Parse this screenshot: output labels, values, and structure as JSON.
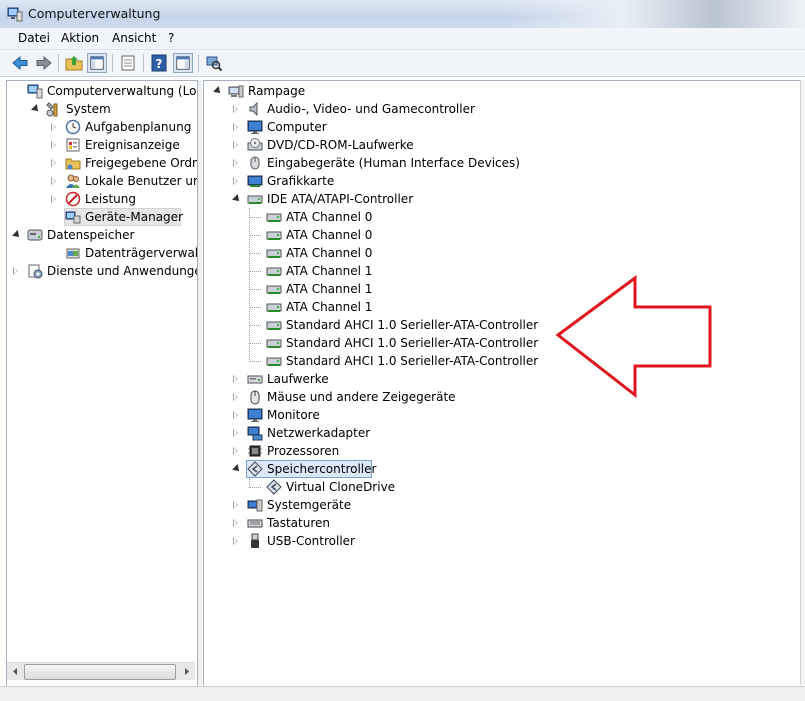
{
  "window": {
    "title": "Computerverwaltung"
  },
  "menu": [
    "Datei",
    "Aktion",
    "Ansicht",
    "?"
  ],
  "toolbar": {
    "buttons": [
      "back-arrow-icon",
      "forward-arrow-icon",
      "up-folder-icon",
      "show-hide-console-tree-icon",
      "properties-icon",
      "help-icon",
      "show-hide-action-pane-icon",
      "scan-hardware-icon"
    ]
  },
  "left_tree": [
    {
      "label": "Computerverwaltung (Lokal)",
      "icon": "computer-management-icon",
      "expander": "none",
      "level": 0
    },
    {
      "label": "System",
      "icon": "system-tools-icon",
      "expander": "open",
      "level": 1
    },
    {
      "label": "Aufgabenplanung",
      "icon": "clock-icon",
      "expander": "closed",
      "level": 2
    },
    {
      "label": "Ereignisanzeige",
      "icon": "event-viewer-icon",
      "expander": "closed",
      "level": 2
    },
    {
      "label": "Freigegebene Ordner",
      "icon": "shared-folder-icon",
      "expander": "closed",
      "level": 2
    },
    {
      "label": "Lokale Benutzer und Gr",
      "icon": "users-icon",
      "expander": "closed",
      "level": 2
    },
    {
      "label": "Leistung",
      "icon": "performance-icon",
      "expander": "closed",
      "level": 2
    },
    {
      "label": "Geräte-Manager",
      "icon": "device-manager-icon",
      "expander": "none",
      "level": 2,
      "selected": true
    },
    {
      "label": "Datenspeicher",
      "icon": "storage-icon",
      "expander": "open",
      "level": 0
    },
    {
      "label": "Datenträgerverwaltung",
      "icon": "disk-management-icon",
      "expander": "none",
      "level": 2
    },
    {
      "label": "Dienste und Anwendungen",
      "icon": "services-icon",
      "expander": "closed",
      "level": 0
    }
  ],
  "device_tree": [
    {
      "label": "Rampage",
      "icon": "computer-root-icon",
      "expander": "open",
      "level": 0
    },
    {
      "label": "Audio-, Video- und Gamecontroller",
      "icon": "speaker-icon",
      "expander": "closed",
      "level": 1
    },
    {
      "label": "Computer",
      "icon": "monitor-icon",
      "expander": "closed",
      "level": 1
    },
    {
      "label": "DVD/CD-ROM-Laufwerke",
      "icon": "cd-drive-icon",
      "expander": "closed",
      "level": 1
    },
    {
      "label": "Eingabegeräte (Human Interface Devices)",
      "icon": "hid-icon",
      "expander": "closed",
      "level": 1
    },
    {
      "label": "Grafikkarte",
      "icon": "display-adapter-icon",
      "expander": "closed",
      "level": 1
    },
    {
      "label": "IDE ATA/ATAPI-Controller",
      "icon": "ide-controller-icon",
      "expander": "open",
      "level": 1
    },
    {
      "label": "ATA Channel 0",
      "icon": "ide-channel-icon",
      "level": 2
    },
    {
      "label": "ATA Channel 0",
      "icon": "ide-channel-icon",
      "level": 2
    },
    {
      "label": "ATA Channel 0",
      "icon": "ide-channel-icon",
      "level": 2
    },
    {
      "label": "ATA Channel 1",
      "icon": "ide-channel-icon",
      "level": 2
    },
    {
      "label": "ATA Channel 1",
      "icon": "ide-channel-icon",
      "level": 2
    },
    {
      "label": "ATA Channel 1",
      "icon": "ide-channel-icon",
      "level": 2
    },
    {
      "label": "Standard AHCI 1.0 Serieller-ATA-Controller",
      "icon": "ide-channel-icon",
      "level": 2
    },
    {
      "label": "Standard AHCI 1.0 Serieller-ATA-Controller",
      "icon": "ide-channel-icon",
      "level": 2
    },
    {
      "label": "Standard AHCI 1.0 Serieller-ATA-Controller",
      "icon": "ide-channel-icon",
      "level": 2
    },
    {
      "label": "Laufwerke",
      "icon": "disk-drive-icon",
      "expander": "closed",
      "level": 1
    },
    {
      "label": "Mäuse und andere Zeigegeräte",
      "icon": "mouse-icon",
      "expander": "closed",
      "level": 1
    },
    {
      "label": "Monitore",
      "icon": "monitor-icon",
      "expander": "closed",
      "level": 1
    },
    {
      "label": "Netzwerkadapter",
      "icon": "network-adapter-icon",
      "expander": "closed",
      "level": 1
    },
    {
      "label": "Prozessoren",
      "icon": "processor-icon",
      "expander": "closed",
      "level": 1
    },
    {
      "label": "Speichercontroller",
      "icon": "storage-controller-icon",
      "expander": "open",
      "level": 1,
      "selected": true
    },
    {
      "label": "Virtual CloneDrive",
      "icon": "storage-controller-icon",
      "level": 2
    },
    {
      "label": "Systemgeräte",
      "icon": "system-devices-icon",
      "expander": "closed",
      "level": 1
    },
    {
      "label": "Tastaturen",
      "icon": "keyboard-icon",
      "expander": "closed",
      "level": 1
    },
    {
      "label": "USB-Controller",
      "icon": "usb-icon",
      "expander": "closed",
      "level": 1
    }
  ],
  "annotation": {
    "shape": "red-arrow-outline",
    "color": "#e0141e"
  },
  "colors": {
    "selection_blue": "#dbe8f7",
    "selection_gray": "#e6e6e6",
    "arrow_red": "#e0141e"
  }
}
